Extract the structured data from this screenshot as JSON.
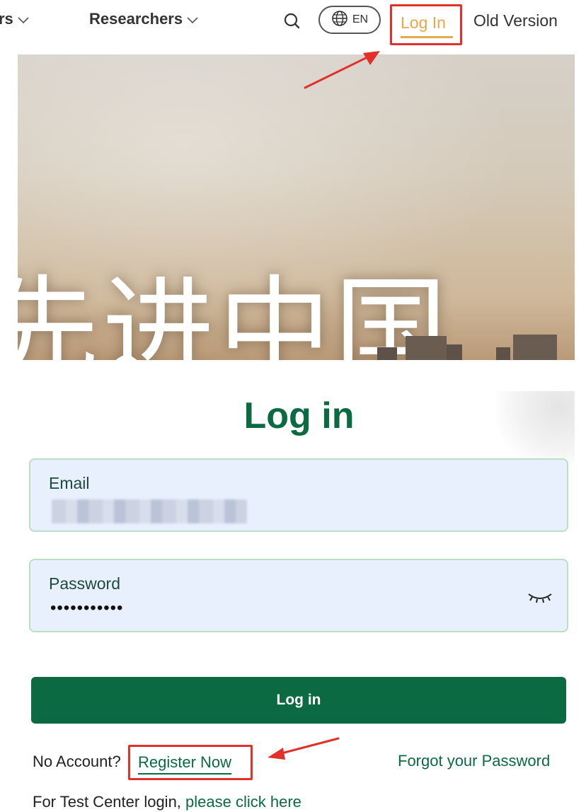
{
  "nav": {
    "partial_item_label": "rs",
    "researchers_label": "Researchers",
    "language_label": "EN",
    "login_label": "Log In",
    "old_version_label": "Old Version"
  },
  "hero": {
    "banner_text": "先进中国"
  },
  "login": {
    "title": "Log in",
    "email_label": "Email",
    "password_label": "Password",
    "password_mask": "•••••••••••",
    "submit_label": "Log in",
    "no_account_text": "No Account?",
    "register_label": "Register Now",
    "forgot_label": "Forgot your Password",
    "test_center_prefix": "For Test Center login,",
    "test_center_link": "please click here"
  },
  "colors": {
    "brand_green": "#0c6a43",
    "accent_orange": "#e8a84c",
    "annotation_red": "#e0312b",
    "field_bg": "#e8f0fe"
  }
}
